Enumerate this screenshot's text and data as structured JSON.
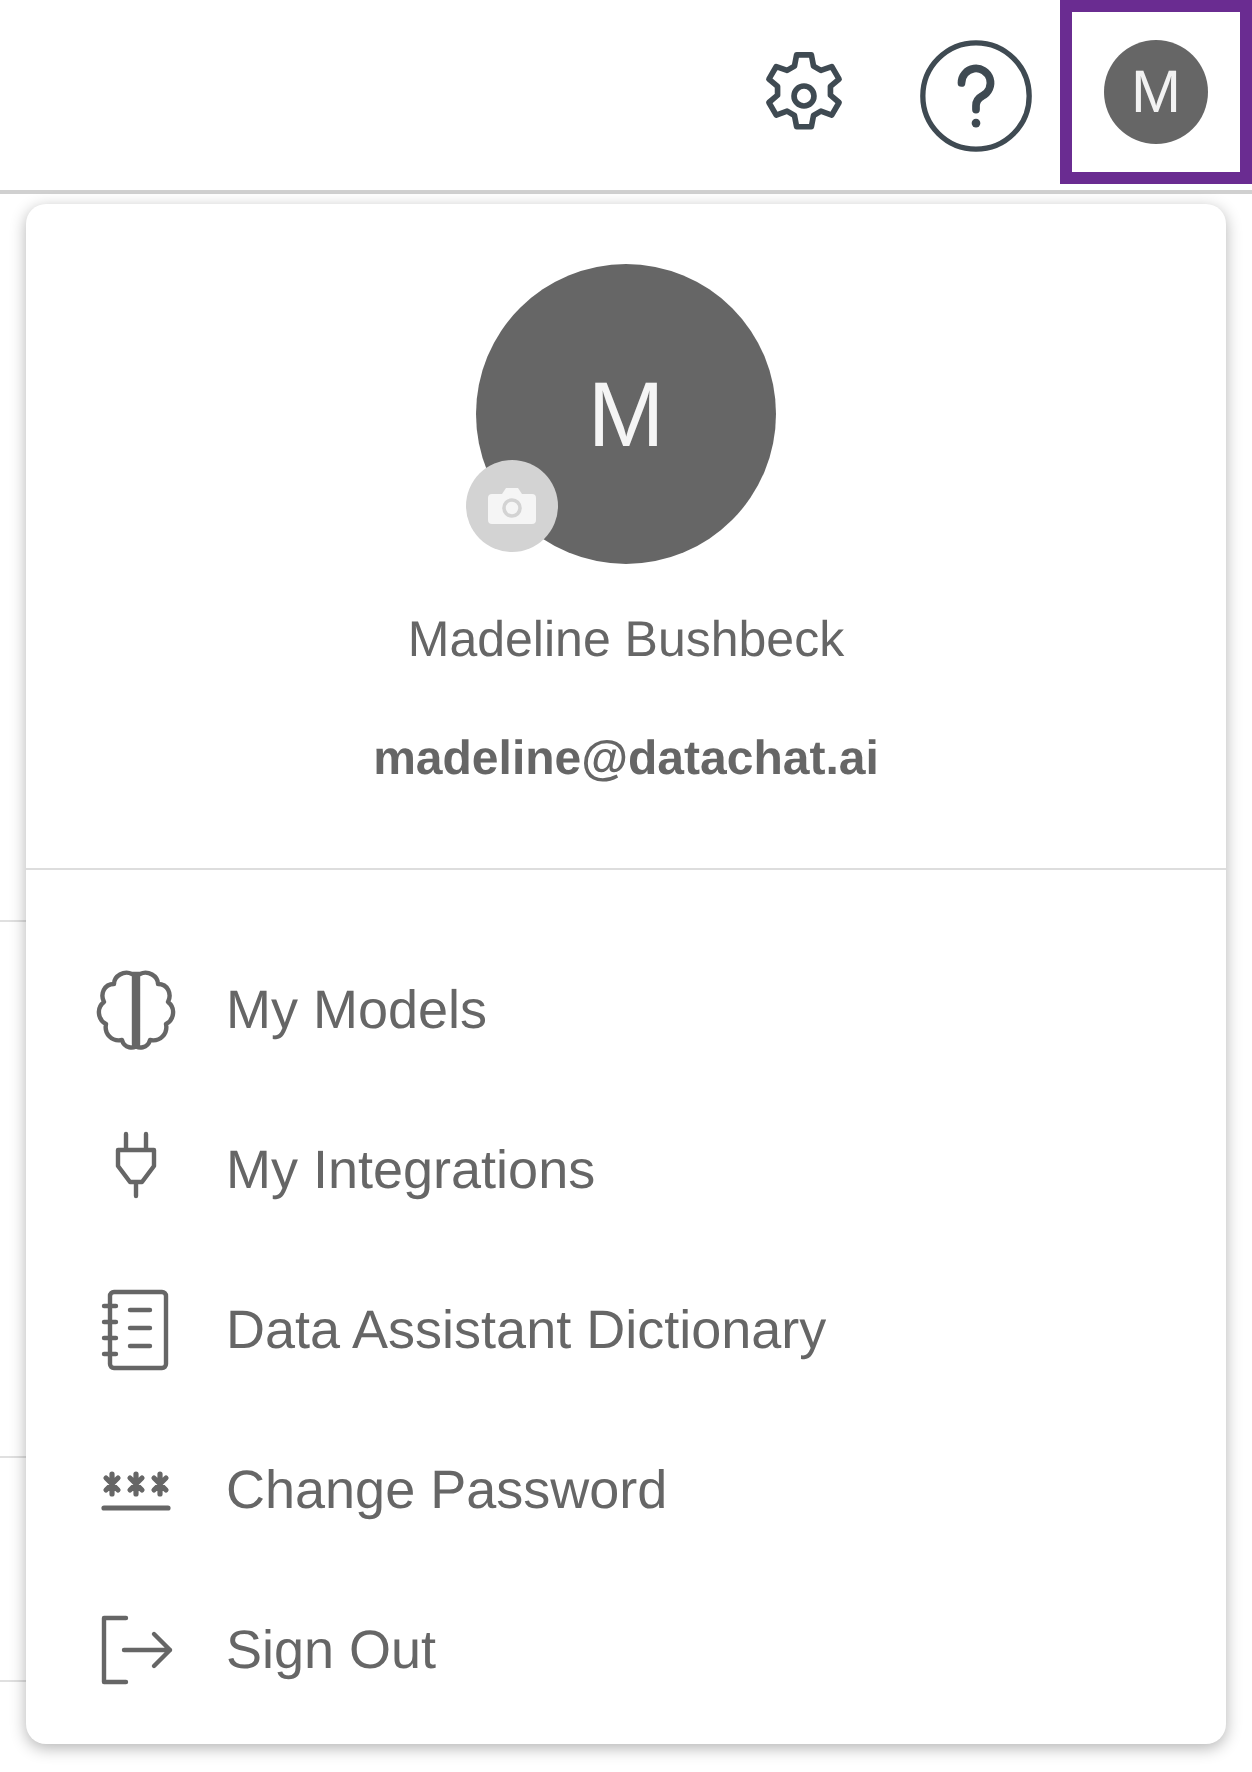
{
  "header": {
    "avatar_initial": "M"
  },
  "profile": {
    "initial": "M",
    "name": "Madeline Bushbeck",
    "email": "madeline@datachat.ai"
  },
  "menu": [
    {
      "kind": "models",
      "label": "My Models"
    },
    {
      "kind": "integrations",
      "label": "My Integrations"
    },
    {
      "kind": "dictionary",
      "label": "Data Assistant Dictionary"
    },
    {
      "kind": "password",
      "label": "Change Password"
    },
    {
      "kind": "signout",
      "label": "Sign Out"
    }
  ]
}
